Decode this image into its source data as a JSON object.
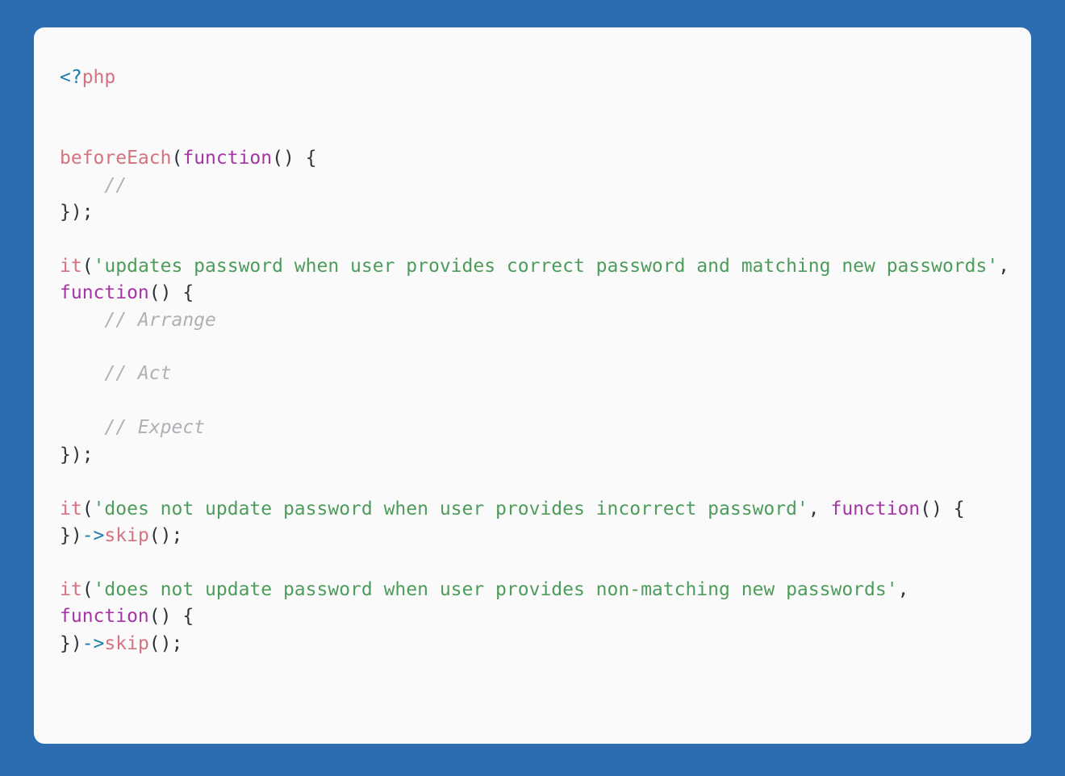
{
  "colors": {
    "page_background": "#2c6cb0",
    "card_background": "#fafafa",
    "text_default": "#2d3338",
    "string": "#4e9c5b",
    "comment": "#adb1b5",
    "keyword_function_name": "#d4737f",
    "function_keyword": "#a535a5",
    "php_tag_bracket": "#1a7fa8",
    "arrow_operator": "#1a7fa8"
  },
  "code": {
    "language": "php",
    "lines": [
      {
        "id": "line-1",
        "tokens": [
          {
            "t": "<?",
            "c": "tok-tag"
          },
          {
            "t": "php",
            "c": "tok-php"
          }
        ]
      },
      {
        "id": "line-2",
        "tokens": []
      },
      {
        "id": "line-3",
        "tokens": []
      },
      {
        "id": "line-4",
        "tokens": [
          {
            "t": "beforeEach",
            "c": "tok-fn"
          },
          {
            "t": "(",
            "c": "tok-plain"
          },
          {
            "t": "function",
            "c": "tok-func"
          },
          {
            "t": "() {",
            "c": "tok-plain"
          }
        ]
      },
      {
        "id": "line-5",
        "tokens": [
          {
            "t": "    ",
            "c": "tok-plain"
          },
          {
            "t": "//",
            "c": "tok-comment"
          }
        ]
      },
      {
        "id": "line-6",
        "tokens": [
          {
            "t": "});",
            "c": "tok-plain"
          }
        ]
      },
      {
        "id": "line-7",
        "tokens": []
      },
      {
        "id": "line-8",
        "tokens": [
          {
            "t": "it",
            "c": "tok-fn"
          },
          {
            "t": "(",
            "c": "tok-plain"
          },
          {
            "t": "'updates password when user provides correct password and matching new passwords'",
            "c": "tok-str"
          },
          {
            "t": ", ",
            "c": "tok-plain"
          },
          {
            "t": "function",
            "c": "tok-func"
          },
          {
            "t": "() {",
            "c": "tok-plain"
          }
        ]
      },
      {
        "id": "line-9",
        "tokens": [
          {
            "t": "    ",
            "c": "tok-plain"
          },
          {
            "t": "// Arrange",
            "c": "tok-comment"
          }
        ]
      },
      {
        "id": "line-10",
        "tokens": []
      },
      {
        "id": "line-11",
        "tokens": [
          {
            "t": "    ",
            "c": "tok-plain"
          },
          {
            "t": "// Act",
            "c": "tok-comment"
          }
        ]
      },
      {
        "id": "line-12",
        "tokens": []
      },
      {
        "id": "line-13",
        "tokens": [
          {
            "t": "    ",
            "c": "tok-plain"
          },
          {
            "t": "// Expect",
            "c": "tok-comment"
          }
        ]
      },
      {
        "id": "line-14",
        "tokens": [
          {
            "t": "});",
            "c": "tok-plain"
          }
        ]
      },
      {
        "id": "line-15",
        "tokens": []
      },
      {
        "id": "line-16",
        "tokens": [
          {
            "t": "it",
            "c": "tok-fn"
          },
          {
            "t": "(",
            "c": "tok-plain"
          },
          {
            "t": "'does not update password when user provides incorrect password'",
            "c": "tok-str"
          },
          {
            "t": ", ",
            "c": "tok-plain"
          },
          {
            "t": "function",
            "c": "tok-func"
          },
          {
            "t": "() {",
            "c": "tok-plain"
          }
        ]
      },
      {
        "id": "line-17",
        "tokens": [
          {
            "t": "})",
            "c": "tok-plain"
          },
          {
            "t": "->",
            "c": "tok-arrow"
          },
          {
            "t": "skip",
            "c": "tok-kw"
          },
          {
            "t": "();",
            "c": "tok-plain"
          }
        ]
      },
      {
        "id": "line-18",
        "tokens": []
      },
      {
        "id": "line-19",
        "tokens": [
          {
            "t": "it",
            "c": "tok-fn"
          },
          {
            "t": "(",
            "c": "tok-plain"
          },
          {
            "t": "'does not update password when user provides non-matching new passwords'",
            "c": "tok-str"
          },
          {
            "t": ", ",
            "c": "tok-plain"
          },
          {
            "t": "function",
            "c": "tok-func"
          },
          {
            "t": "() {",
            "c": "tok-plain"
          }
        ]
      },
      {
        "id": "line-20",
        "tokens": [
          {
            "t": "})",
            "c": "tok-plain"
          },
          {
            "t": "->",
            "c": "tok-arrow"
          },
          {
            "t": "skip",
            "c": "tok-kw"
          },
          {
            "t": "();",
            "c": "tok-plain"
          }
        ]
      }
    ],
    "plain_text": "<?php\n\n\nbeforeEach(function() {\n    //\n});\n\nit('updates password when user provides correct password and matching new passwords', function() {\n    // Arrange\n\n    // Act\n\n    // Expect\n});\n\nit('does not update password when user provides incorrect password', function() {\n})->skip();\n\nit('does not update password when user provides non-matching new passwords', function() {\n})->skip();"
  }
}
